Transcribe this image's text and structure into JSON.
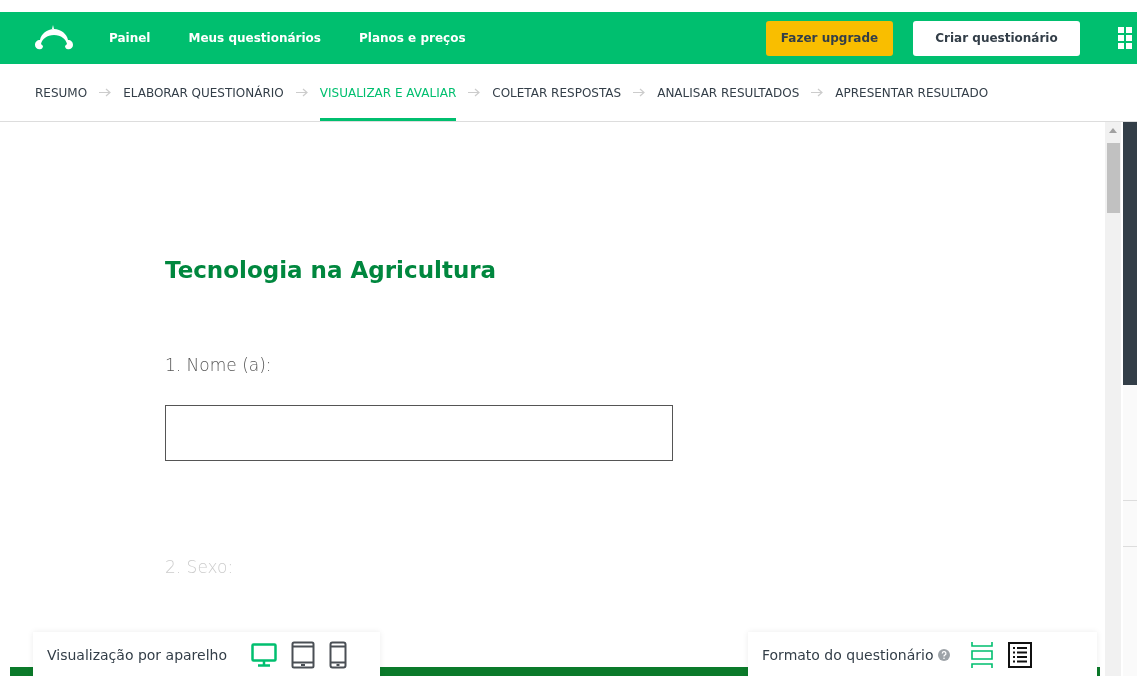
{
  "header": {
    "nav": [
      "Painel",
      "Meus questionários",
      "Planos e preços"
    ],
    "upgrade_button": "Fazer upgrade",
    "create_button": "Criar questionário"
  },
  "steps": [
    {
      "label": "RESUMO",
      "selected": false
    },
    {
      "label": "ELABORAR QUESTIONÁRIO",
      "selected": false
    },
    {
      "label": "VISUALIZAR E AVALIAR",
      "selected": true
    },
    {
      "label": "COLETAR RESPOSTAS",
      "selected": false
    },
    {
      "label": "ANALISAR RESULTADOS",
      "selected": false
    },
    {
      "label": "APRESENTAR RESULTADO",
      "selected": false
    }
  ],
  "survey": {
    "title": "Tecnologia na Agricultura",
    "questions": [
      {
        "label": "1. Nome (a):",
        "kind": "text",
        "disabled": false
      },
      {
        "label": "2. Sexo:",
        "kind": "heading",
        "disabled": true
      }
    ]
  },
  "device_bar": {
    "label": "Visualização por aparelho",
    "devices": [
      {
        "kind": "desktop",
        "selected": true
      },
      {
        "kind": "tablet",
        "selected": false
      },
      {
        "kind": "phone",
        "selected": false
      }
    ]
  },
  "format_bar": {
    "label": "Formato do questionário",
    "formats": [
      {
        "kind": "one-at-a-time",
        "selected": true
      },
      {
        "kind": "classic",
        "selected": false
      }
    ]
  }
}
